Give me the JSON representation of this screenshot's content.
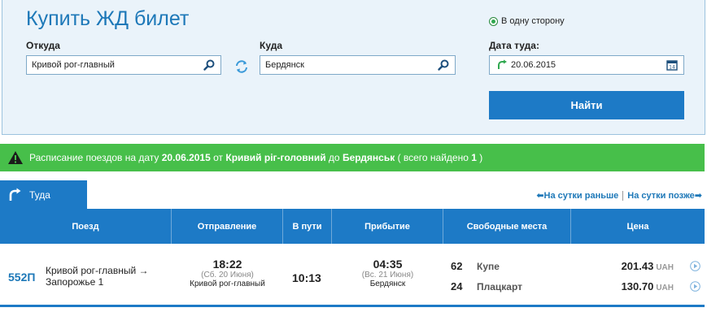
{
  "search": {
    "title": "Купить ЖД билет",
    "from_label": "Откуда",
    "from_value": "Кривой рог-главный",
    "to_label": "Куда",
    "to_value": "Бердянск",
    "one_way_label": "В одну сторону",
    "date_label": "Дата туда:",
    "date_value": "20.06.2015",
    "find_button": "Найти"
  },
  "banner": {
    "prefix": "Расписание поездов на дату",
    "date": "20.06.2015",
    "from_word": "от",
    "from": "Кривий ріг-головний",
    "to_word": "до",
    "to": "Бердянськ",
    "found_prefix": "( всего найдено",
    "found_count": "1",
    "found_suffix": ")"
  },
  "results": {
    "tab_label": "Туда",
    "prev_day": "На сутки раньше",
    "next_day": "На сутки позже",
    "columns": [
      "Поезд",
      "Отправление",
      "В пути",
      "Прибытие",
      "Свободные места",
      "Цена"
    ],
    "train": {
      "number": "552П",
      "route_line1": "Кривой рог-главный →",
      "route_line2": "Запорожье 1",
      "dep_time": "18:22",
      "dep_date": "(Сб. 20 Июня)",
      "dep_station": "Кривой рог-главный",
      "duration": "10:13",
      "arr_time": "04:35",
      "arr_date": "(Вс. 21 Июня)",
      "arr_station": "Бердянск",
      "seats": [
        {
          "count": "62",
          "type": "Купе",
          "price": "201.43",
          "currency": "UAH"
        },
        {
          "count": "24",
          "type": "Плацкарт",
          "price": "130.70",
          "currency": "UAH"
        }
      ]
    }
  },
  "colors": {
    "primary": "#1d7ac6",
    "banner_green": "#47bf4a",
    "panel_bg": "#eaf3fa"
  }
}
